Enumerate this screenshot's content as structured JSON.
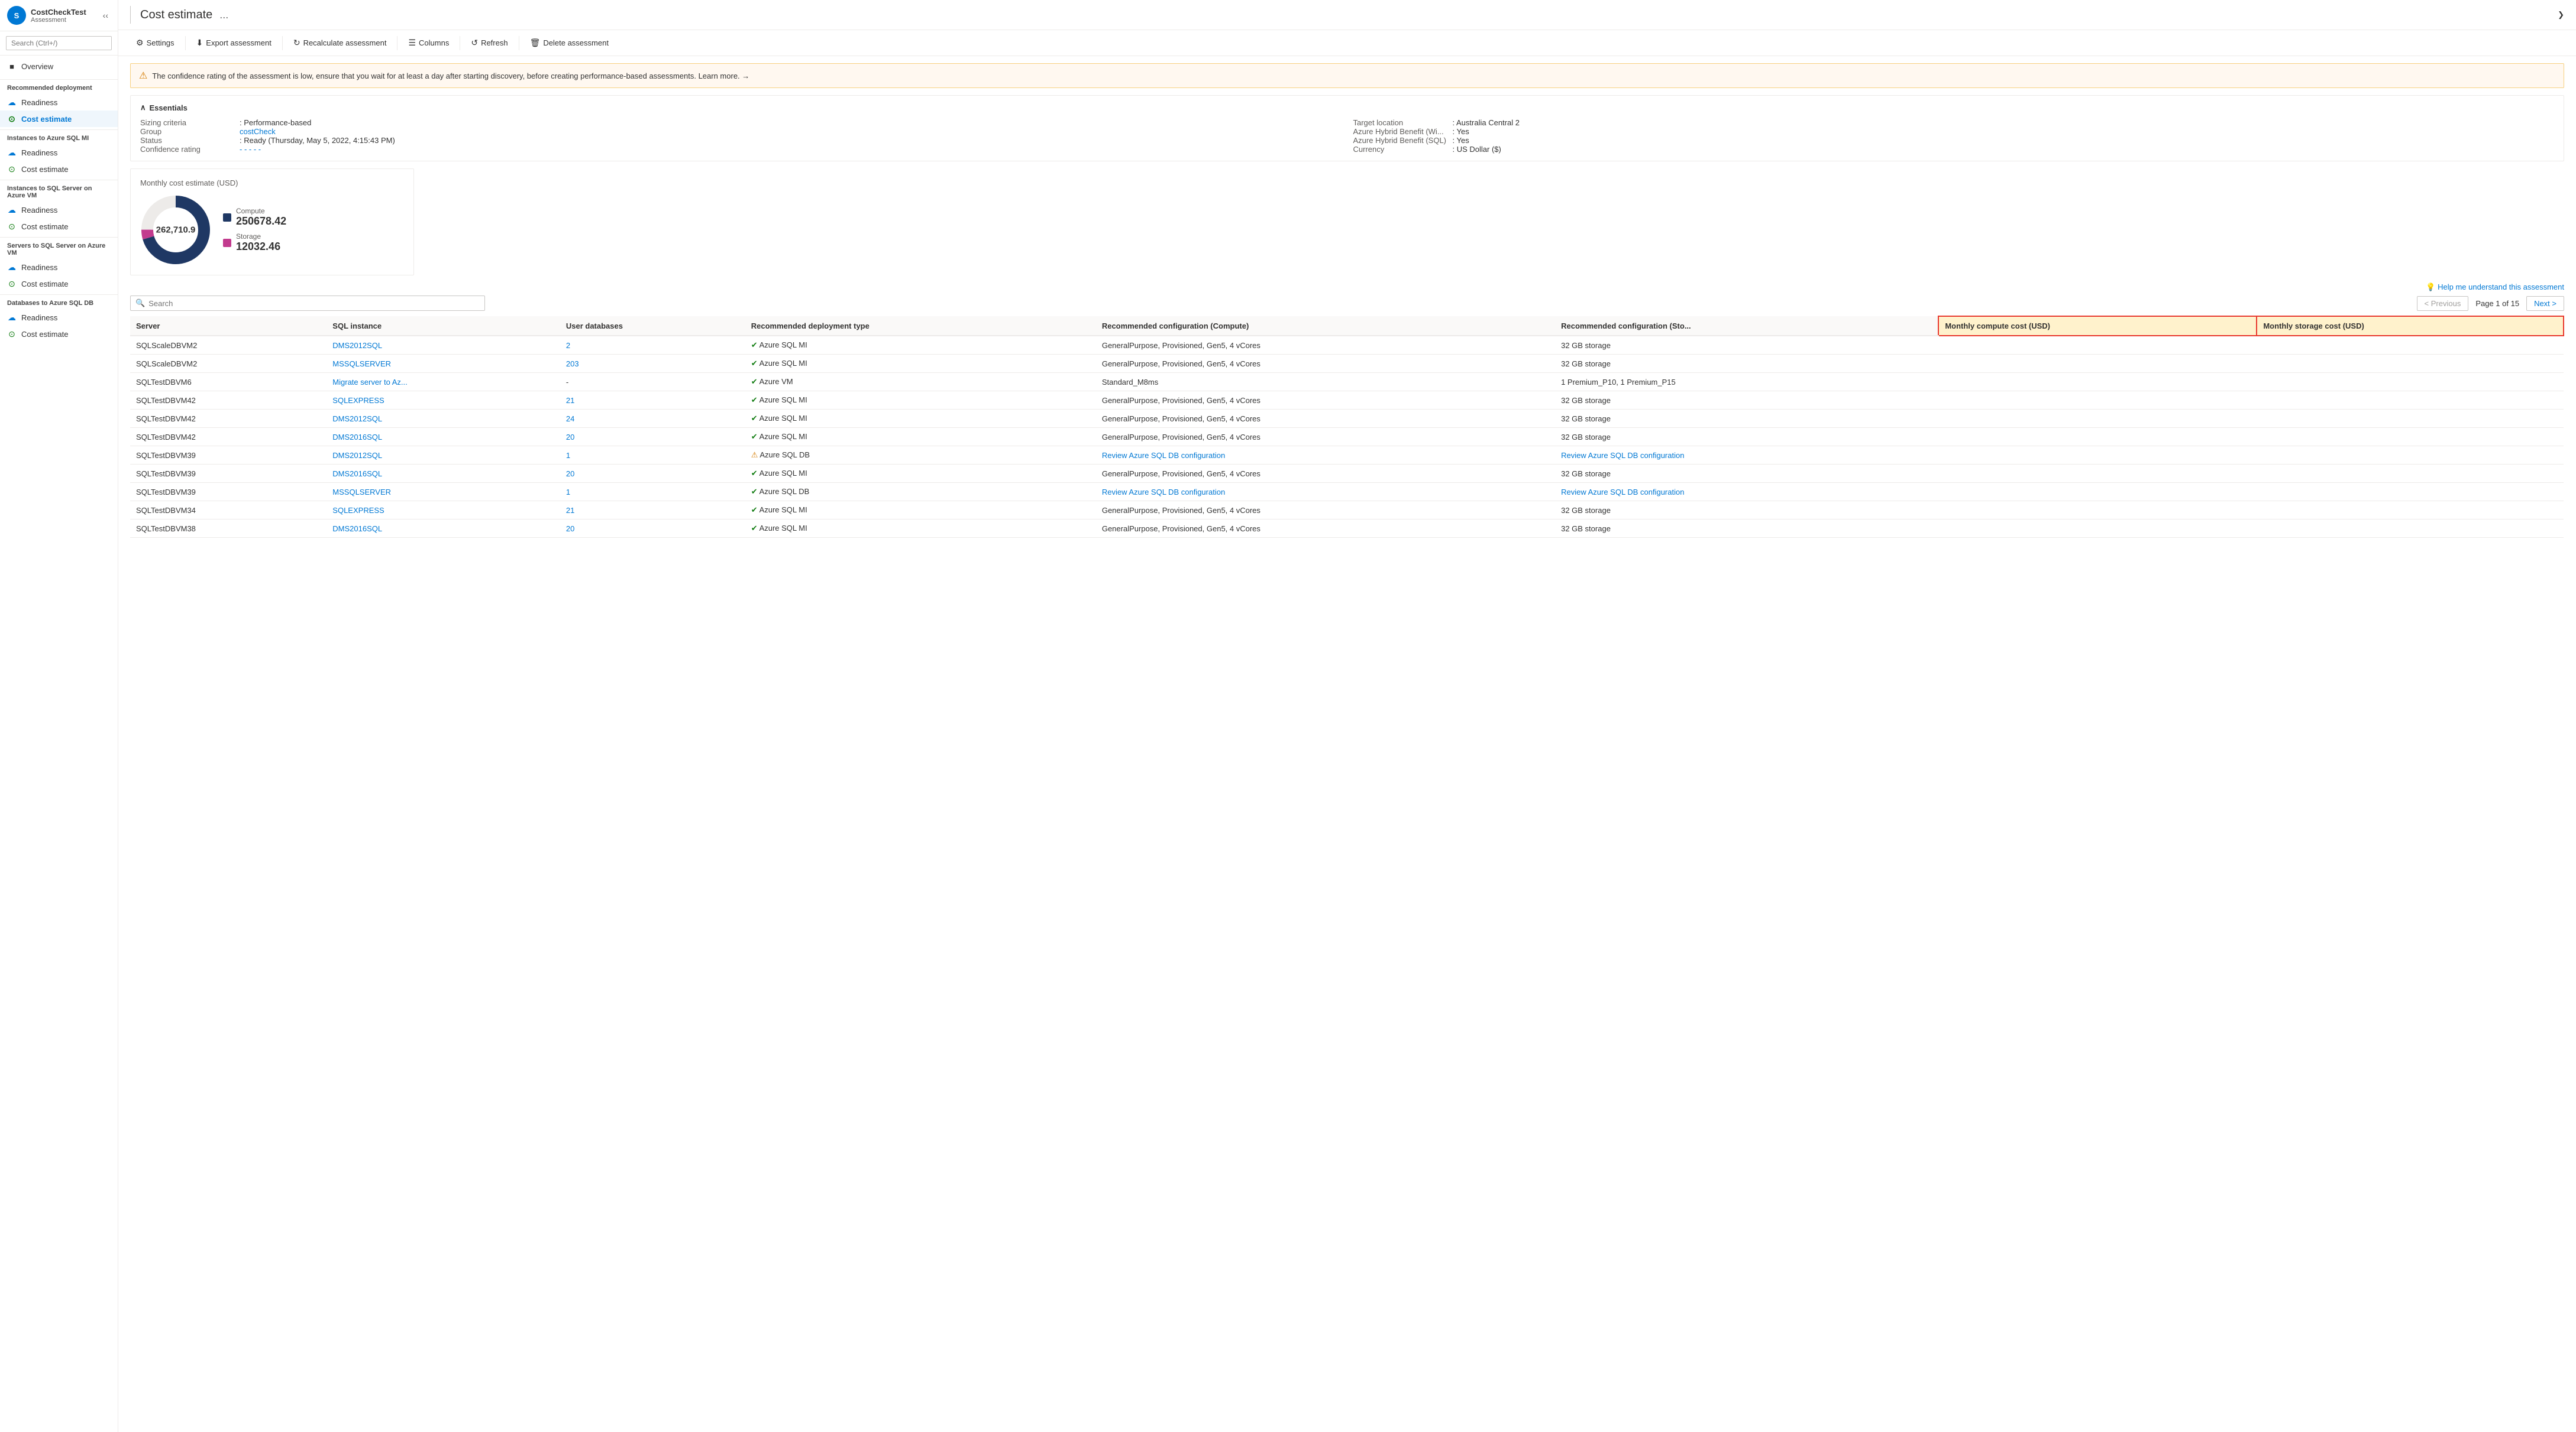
{
  "app": {
    "logo": "S",
    "name": "CostCheckTest",
    "subtitle": "Assessment"
  },
  "search": {
    "placeholder": "Search (Ctrl+/)"
  },
  "header": {
    "title": "Cost estimate",
    "dots": "..."
  },
  "toolbar": {
    "settings": "Settings",
    "export": "Export assessment",
    "recalculate": "Recalculate assessment",
    "columns": "Columns",
    "refresh": "Refresh",
    "delete": "Delete assessment"
  },
  "alert": {
    "message": "The confidence rating of the assessment is low, ensure that you wait for at least a day after starting discovery, before creating performance-based assessments. Learn more. →"
  },
  "essentials": {
    "title": "Essentials",
    "left": [
      {
        "label": "Sizing criteria",
        "value": ": Performance-based",
        "link": false
      },
      {
        "label": "Group",
        "value": "costCheck",
        "link": true
      },
      {
        "label": "Status",
        "value": ": Ready (Thursday, May 5, 2022, 4:15:43 PM)",
        "link": false
      },
      {
        "label": "Confidence rating",
        "value": "- - - - -",
        "link": true
      }
    ],
    "right": [
      {
        "label": "Target location",
        "value": ": Australia Central 2",
        "link": false
      },
      {
        "label": "Azure Hybrid Benefit (Wi...",
        "value": ": Yes",
        "link": false
      },
      {
        "label": "Azure Hybrid Benefit (SQL)",
        "value": ": Yes",
        "link": false
      },
      {
        "label": "Currency",
        "value": ": US Dollar ($)",
        "link": false
      }
    ]
  },
  "chart": {
    "title": "Monthly cost estimate (USD)",
    "center": "262,710.9",
    "compute_label": "Compute",
    "compute_value": "250678.42",
    "storage_label": "Storage",
    "storage_value": "12032.46",
    "compute_color": "#1f3864",
    "storage_color": "#c23b8e",
    "compute_pct": 95.4,
    "storage_pct": 4.6
  },
  "help_link": "💡 Help me understand this assessment",
  "table_search_placeholder": "Search",
  "pagination": {
    "previous": "< Previous",
    "page_info": "Page 1 of 15",
    "next": "Next >"
  },
  "table": {
    "headers": [
      "Server",
      "SQL instance",
      "User databases",
      "Recommended deployment type",
      "Recommended configuration (Compute)",
      "Recommended configuration (Sto...",
      "Monthly compute cost (USD)",
      "Monthly storage cost (USD)"
    ],
    "rows": [
      {
        "server": "SQLScaleDBVM2",
        "sql_instance": "DMS2012SQL",
        "user_db": "2",
        "deploy_type": "Azure SQL MI",
        "deploy_status": "ok",
        "config_compute": "GeneralPurpose, Provisioned, Gen5, 4 vCores",
        "config_storage": "32 GB storage",
        "monthly_compute": "",
        "monthly_storage": ""
      },
      {
        "server": "SQLScaleDBVM2",
        "sql_instance": "MSSQLSERVER",
        "user_db": "203",
        "deploy_type": "Azure SQL MI",
        "deploy_status": "ok",
        "config_compute": "GeneralPurpose, Provisioned, Gen5, 4 vCores",
        "config_storage": "32 GB storage",
        "monthly_compute": "",
        "monthly_storage": ""
      },
      {
        "server": "SQLTestDBVM6",
        "sql_instance": "Migrate server to Az...",
        "user_db": "-",
        "deploy_type": "Azure VM",
        "deploy_status": "ok",
        "config_compute": "Standard_M8ms",
        "config_storage": "1 Premium_P10, 1 Premium_P15",
        "monthly_compute": "",
        "monthly_storage": ""
      },
      {
        "server": "SQLTestDBVM42",
        "sql_instance": "SQLEXPRESS",
        "user_db": "21",
        "deploy_type": "Azure SQL MI",
        "deploy_status": "ok",
        "config_compute": "GeneralPurpose, Provisioned, Gen5, 4 vCores",
        "config_storage": "32 GB storage",
        "monthly_compute": "",
        "monthly_storage": ""
      },
      {
        "server": "SQLTestDBVM42",
        "sql_instance": "DMS2012SQL",
        "user_db": "24",
        "deploy_type": "Azure SQL MI",
        "deploy_status": "ok",
        "config_compute": "GeneralPurpose, Provisioned, Gen5, 4 vCores",
        "config_storage": "32 GB storage",
        "monthly_compute": "",
        "monthly_storage": ""
      },
      {
        "server": "SQLTestDBVM42",
        "sql_instance": "DMS2016SQL",
        "user_db": "20",
        "deploy_type": "Azure SQL MI",
        "deploy_status": "ok",
        "config_compute": "GeneralPurpose, Provisioned, Gen5, 4 vCores",
        "config_storage": "32 GB storage",
        "monthly_compute": "",
        "monthly_storage": ""
      },
      {
        "server": "SQLTestDBVM39",
        "sql_instance": "DMS2012SQL",
        "user_db": "1",
        "deploy_type": "Azure SQL DB",
        "deploy_status": "warn",
        "config_compute": "Review Azure SQL DB configuration",
        "config_storage": "Review Azure SQL DB configuration",
        "config_compute_link": true,
        "config_storage_link": true,
        "monthly_compute": "",
        "monthly_storage": ""
      },
      {
        "server": "SQLTestDBVM39",
        "sql_instance": "DMS2016SQL",
        "user_db": "20",
        "deploy_type": "Azure SQL MI",
        "deploy_status": "ok",
        "config_compute": "GeneralPurpose, Provisioned, Gen5, 4 vCores",
        "config_storage": "32 GB storage",
        "monthly_compute": "",
        "monthly_storage": ""
      },
      {
        "server": "SQLTestDBVM39",
        "sql_instance": "MSSQLSERVER",
        "user_db": "1",
        "deploy_type": "Azure SQL DB",
        "deploy_status": "ok",
        "config_compute": "Review Azure SQL DB configuration",
        "config_storage": "Review Azure SQL DB configuration",
        "config_compute_link": true,
        "config_storage_link": true,
        "monthly_compute": "",
        "monthly_storage": ""
      },
      {
        "server": "SQLTestDBVM34",
        "sql_instance": "SQLEXPRESS",
        "user_db": "21",
        "deploy_type": "Azure SQL MI",
        "deploy_status": "ok",
        "config_compute": "GeneralPurpose, Provisioned, Gen5, 4 vCores",
        "config_storage": "32 GB storage",
        "monthly_compute": "",
        "monthly_storage": ""
      },
      {
        "server": "SQLTestDBVM38",
        "sql_instance": "DMS2016SQL",
        "user_db": "20",
        "deploy_type": "Azure SQL MI",
        "deploy_status": "ok",
        "config_compute": "GeneralPurpose, Provisioned, Gen5, 4 vCores",
        "config_storage": "32 GB storage",
        "monthly_compute": "",
        "monthly_storage": ""
      }
    ]
  },
  "sidebar": {
    "overview": "Overview",
    "sections": [
      {
        "title": "Recommended deployment",
        "items": [
          {
            "label": "Readiness",
            "icon": "cloud",
            "active": false
          },
          {
            "label": "Cost estimate",
            "icon": "green",
            "active": true
          }
        ]
      },
      {
        "title": "Instances to Azure SQL MI",
        "items": [
          {
            "label": "Readiness",
            "icon": "cloud",
            "active": false
          },
          {
            "label": "Cost estimate",
            "icon": "green",
            "active": false
          }
        ]
      },
      {
        "title": "Instances to SQL Server on Azure VM",
        "items": [
          {
            "label": "Readiness",
            "icon": "cloud",
            "active": false
          },
          {
            "label": "Cost estimate",
            "icon": "green",
            "active": false
          }
        ]
      },
      {
        "title": "Servers to SQL Server on Azure VM",
        "items": [
          {
            "label": "Readiness",
            "icon": "cloud",
            "active": false
          },
          {
            "label": "Cost estimate",
            "icon": "green",
            "active": false
          }
        ]
      },
      {
        "title": "Databases to Azure SQL DB",
        "items": [
          {
            "label": "Readiness",
            "icon": "cloud",
            "active": false
          },
          {
            "label": "Cost estimate",
            "icon": "green",
            "active": false
          }
        ]
      }
    ]
  }
}
